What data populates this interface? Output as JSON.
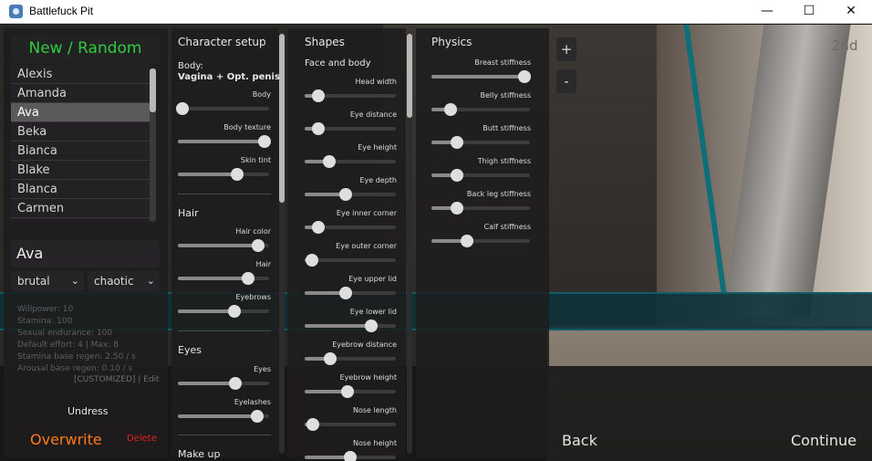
{
  "window": {
    "title": "Battlefuck Pit",
    "minimize": "—",
    "maximize": "☐",
    "close": "✕"
  },
  "left": {
    "new_random": "New / Random",
    "characters": [
      "Alexis",
      "Amanda",
      "Ava",
      "Beka",
      "Bianca",
      "Blake",
      "Blanca",
      "Carmen"
    ],
    "selected_index": 2,
    "name": "Ava",
    "dropdown1": "brutal",
    "dropdown2": "chaotic",
    "stats": [
      "Willpower: 10",
      "Stamina: 100",
      "Sexual endurance: 100",
      "Default effort: 4 | Max: 8",
      "Stamina base regen: 2.50 / s",
      "Arousal base regen: 0.10 / s"
    ],
    "customized": "[CUSTOMIZED] | Edit",
    "undress": "Undress",
    "overwrite": "Overwrite",
    "delete": "Delete"
  },
  "character_setup": {
    "title": "Character setup",
    "body_label": "Body:",
    "body_value": "Vagina + Opt. penis",
    "sliders": [
      {
        "label": "Body",
        "value": 0.05
      },
      {
        "label": "Body texture",
        "value": 0.95
      },
      {
        "label": "Skin tint",
        "value": 0.65
      }
    ],
    "hair_title": "Hair",
    "hair_sliders": [
      {
        "label": "Hair color",
        "value": 0.88
      },
      {
        "label": "Hair",
        "value": 0.77
      },
      {
        "label": "Eyebrows",
        "value": 0.62
      }
    ],
    "eyes_title": "Eyes",
    "eyes_sliders": [
      {
        "label": "Eyes",
        "value": 0.63
      },
      {
        "label": "Eyelashes",
        "value": 0.87
      }
    ],
    "makeup_title": "Make up"
  },
  "shapes": {
    "title": "Shapes",
    "subtitle": "Face and body",
    "sliders": [
      {
        "label": "Head width",
        "value": 0.15
      },
      {
        "label": "Eye distance",
        "value": 0.15
      },
      {
        "label": "Eye height",
        "value": 0.27
      },
      {
        "label": "Eye depth",
        "value": 0.45
      },
      {
        "label": "Eye inner corner",
        "value": 0.15
      },
      {
        "label": "Eye outer corner",
        "value": 0.08
      },
      {
        "label": "Eye upper lid",
        "value": 0.45
      },
      {
        "label": "Eye lower lid",
        "value": 0.73
      },
      {
        "label": "Eyebrow distance",
        "value": 0.28
      },
      {
        "label": "Eyebrow height",
        "value": 0.47
      },
      {
        "label": "Nose length",
        "value": 0.09
      },
      {
        "label": "Nose height",
        "value": 0.5
      }
    ]
  },
  "physics": {
    "title": "Physics",
    "sliders": [
      {
        "label": "Breast stiffness",
        "value": 0.94
      },
      {
        "label": "Belly stiffness",
        "value": 0.19
      },
      {
        "label": "Butt stiffness",
        "value": 0.26
      },
      {
        "label": "Thigh stiffness",
        "value": 0.26
      },
      {
        "label": "Back leg stiffness",
        "value": 0.26
      },
      {
        "label": "Calf stiffness",
        "value": 0.36
      }
    ]
  },
  "view": {
    "zoom_in": "+",
    "zoom_out": "-",
    "tag": "2nd"
  },
  "nav": {
    "back": "Back",
    "continue": "Continue"
  }
}
